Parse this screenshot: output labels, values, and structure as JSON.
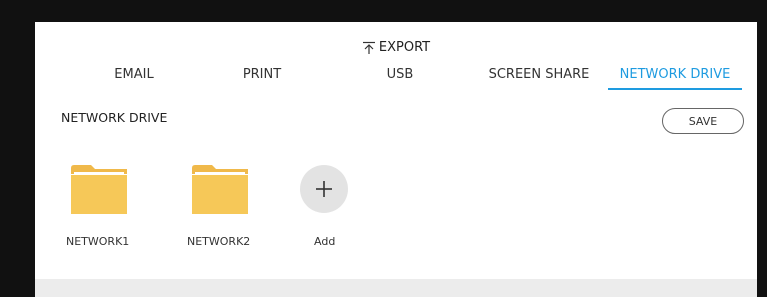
{
  "header": {
    "title": "EXPORT",
    "title_icon": "export-icon"
  },
  "tabs": [
    {
      "label": "EMAIL",
      "active": false
    },
    {
      "label": "PRINT",
      "active": false
    },
    {
      "label": "USB",
      "active": false
    },
    {
      "label": "SCREEN SHARE",
      "active": false
    },
    {
      "label": "NETWORK DRIVE",
      "active": true
    }
  ],
  "section": {
    "title": "NETWORK DRIVE",
    "save_label": "SAVE"
  },
  "drives": [
    {
      "label": "NETWORK1",
      "icon": "folder-icon"
    },
    {
      "label": "NETWORK2",
      "icon": "folder-icon"
    }
  ],
  "add": {
    "label": "Add",
    "icon": "plus-icon"
  },
  "colors": {
    "accent": "#1e9be0",
    "folder": "#f6c858",
    "folder_tab": "#f0b94a"
  }
}
